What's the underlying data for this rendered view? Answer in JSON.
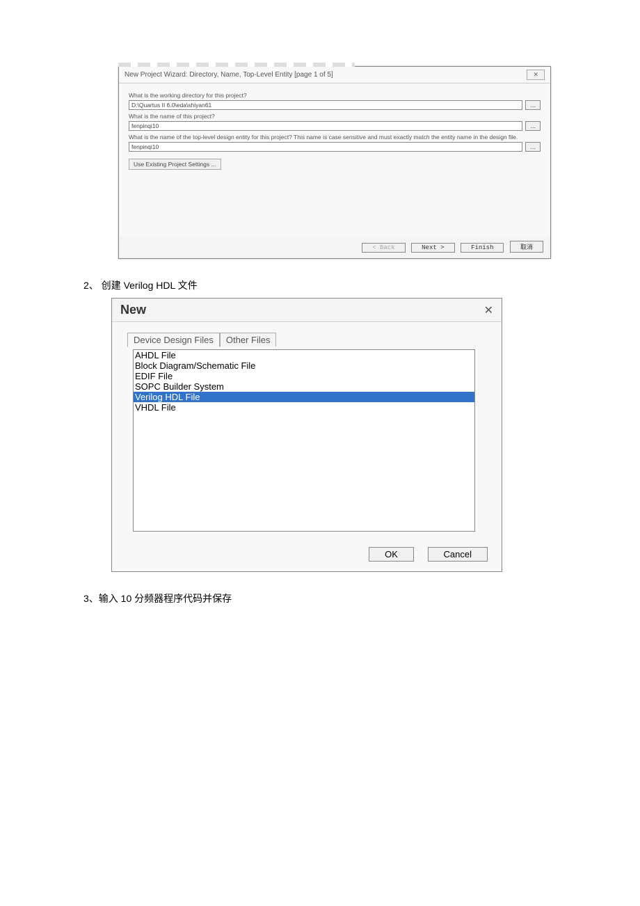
{
  "wizard": {
    "title": "New Project Wizard: Directory, Name, Top-Level Entity [page 1 of 5]",
    "close": "✕",
    "q1": "What is the working directory for this project?",
    "dir_value": "D:\\Quartus II 6.0\\eda\\shiyan61",
    "q2": "What is the name of this project?",
    "name_value": "fenpinqi10",
    "q3": "What is the name of the top-level design entity for this project? This name is case sensitive and must exactly match the entity name in the design file.",
    "entity_value": "fenpinqi10",
    "existing_btn": "Use Existing Project Settings ...",
    "browse": "...",
    "footer": {
      "back": "< Back",
      "next": "Next >",
      "finish": "Finish",
      "cancel": "取消"
    }
  },
  "step2_text": "2、 创建 Verilog HDL 文件",
  "new_dialog": {
    "title": "New",
    "close": "✕",
    "tabs": {
      "active": "Device Design Files",
      "other": "Other Files"
    },
    "items": [
      "AHDL File",
      "Block Diagram/Schematic File",
      "EDIF File",
      "SOPC Builder System",
      "Verilog HDL File",
      "VHDL File"
    ],
    "selected_index": 4,
    "footer": {
      "ok": "OK",
      "cancel": "Cancel"
    }
  },
  "step3_text": "3、输入 10 分频器程序代码并保存"
}
